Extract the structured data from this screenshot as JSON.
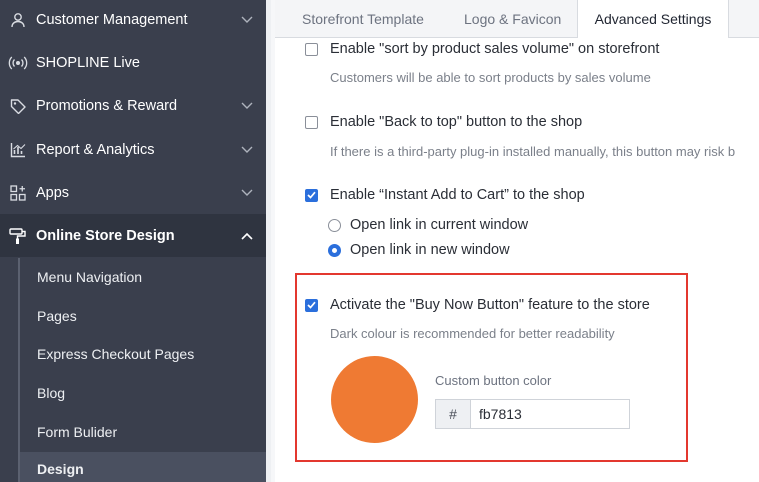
{
  "sidebar": {
    "items": [
      {
        "label": "Customer Management",
        "icon": "user-icon",
        "expandable": true
      },
      {
        "label": "SHOPLINE Live",
        "icon": "broadcast-icon",
        "expandable": false
      },
      {
        "label": "Promotions & Reward",
        "icon": "tag-icon",
        "expandable": true
      },
      {
        "label": "Report & Analytics",
        "icon": "chart-icon",
        "expandable": true
      },
      {
        "label": "Apps",
        "icon": "apps-icon",
        "expandable": true
      },
      {
        "label": "Online Store Design",
        "icon": "paint-roller-icon",
        "expandable": true,
        "expanded": true
      }
    ],
    "subitems": [
      {
        "label": "Menu Navigation"
      },
      {
        "label": "Pages"
      },
      {
        "label": "Express Checkout Pages"
      },
      {
        "label": "Blog"
      },
      {
        "label": "Form Bulider"
      },
      {
        "label": "Design",
        "active": true
      }
    ]
  },
  "tabs": [
    {
      "label": "Storefront Template"
    },
    {
      "label": "Logo & Favicon"
    },
    {
      "label": "Advanced Settings",
      "active": true
    }
  ],
  "settings": {
    "sort_by_sales": {
      "label": "Enable \"sort by product sales volume\" on storefront",
      "checked": false,
      "help": "Customers will be able to sort products by sales volume"
    },
    "back_to_top": {
      "label": "Enable \"Back to top\" button to the shop",
      "checked": false,
      "help": "If there is a third-party plug-in installed manually, this button may risk b"
    },
    "instant_add": {
      "label": "Enable “Instant Add to Cart” to the shop",
      "checked": true
    },
    "open_current": {
      "label": "Open link in current window",
      "selected": false
    },
    "open_new": {
      "label": "Open link in new window",
      "selected": true
    },
    "buy_now": {
      "label": "Activate the \"Buy Now Button\" feature to the store",
      "checked": true,
      "help": "Dark colour is recommended for better readability"
    },
    "custom_color": {
      "label": "Custom button color",
      "prefix": "#",
      "value": "fb7813",
      "swatch": "#ef7a33"
    }
  },
  "colors": {
    "sidebar_bg": "#3a3f4d",
    "accent": "#2b6fdc",
    "highlight_border": "#e3382f"
  }
}
